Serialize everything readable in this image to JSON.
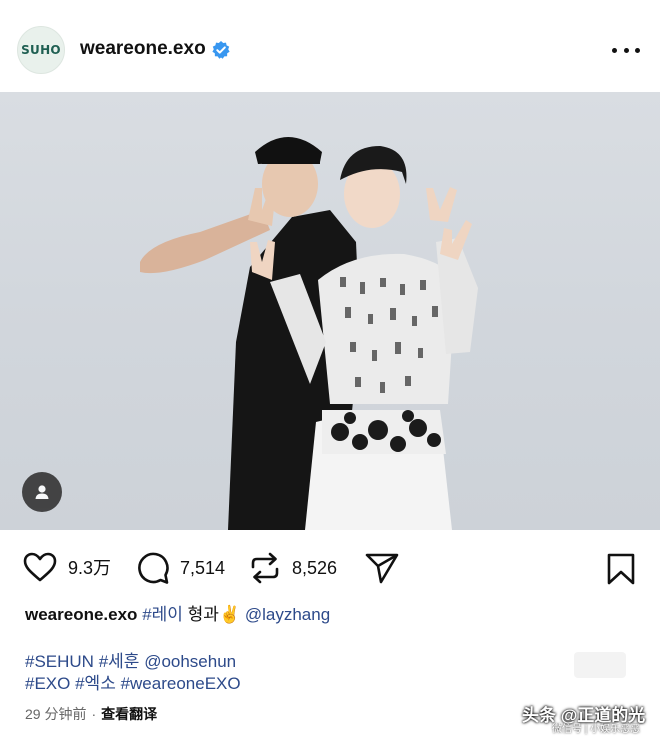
{
  "post": {
    "avatar_text": "SUHO",
    "username": "weareone.exo",
    "verified": true,
    "icons": {
      "verified": "verified-badge-icon",
      "more": "more-options-icon",
      "tag": "tagged-user-icon",
      "like": "heart-icon",
      "comment": "comment-icon",
      "repost": "repost-icon",
      "share": "send-icon",
      "save": "bookmark-icon"
    }
  },
  "actions": {
    "likes": "9.3万",
    "comments": "7,514",
    "reposts": "8,526"
  },
  "caption": {
    "username": "weareone.exo",
    "hashtag": "#레이",
    "text": " 형과✌️ ",
    "mention": "@layzhang"
  },
  "tags_line1": {
    "tag1": "#SEHUN",
    "tag2": "#세훈",
    "mention": "@oohsehun"
  },
  "tags_line2": {
    "tag1": "#EXO",
    "tag2": "#엑소",
    "tag3": "#weareoneEXO"
  },
  "meta": {
    "time": "29 分钟前",
    "separator": "·",
    "translate": "查看翻译"
  },
  "watermark": {
    "main": "头条 @正道的光",
    "sub": "微信号 | 小娱乐恶恶"
  },
  "colors": {
    "link": "#2d4a8a",
    "verified": "#3897f0"
  }
}
